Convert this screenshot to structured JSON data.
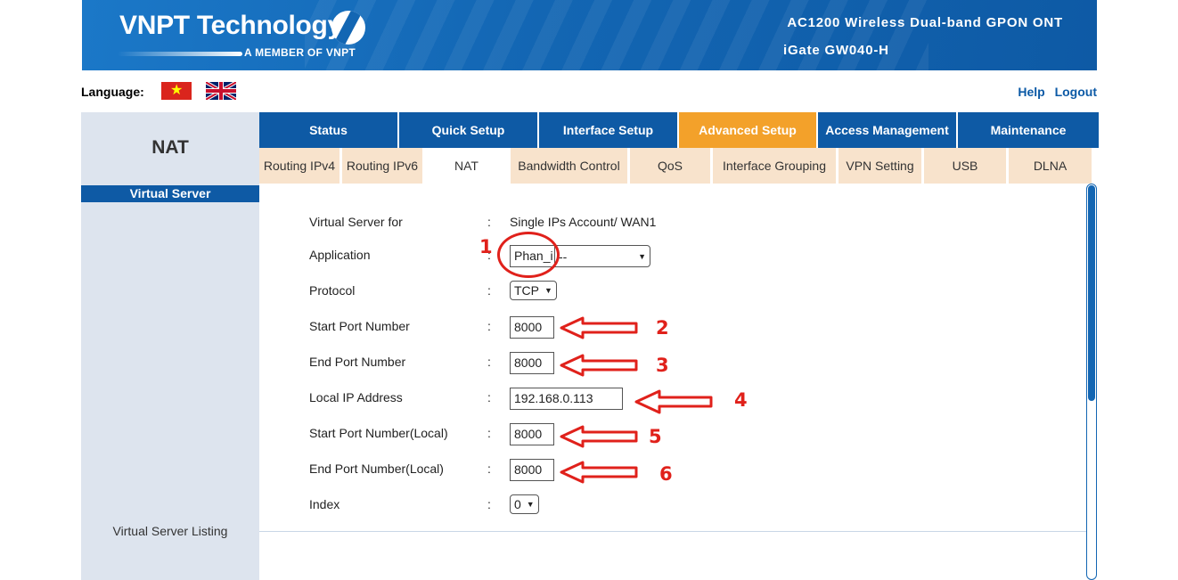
{
  "header": {
    "brand": "VNPT Technology",
    "brand_sub": "A MEMBER OF VNPT",
    "product_line1": "AC1200 Wireless Dual-band GPON ONT",
    "product_line2": "iGate GW040-H"
  },
  "language": {
    "label": "Language:"
  },
  "top_links": {
    "help": "Help",
    "logout": "Logout"
  },
  "main_tabs": [
    "Status",
    "Quick Setup",
    "Interface Setup",
    "Advanced Setup",
    "Access Management",
    "Maintenance"
  ],
  "sub_tabs": [
    "Routing IPv4",
    "Routing IPv6",
    "NAT",
    "Bandwidth Control",
    "QoS",
    "Interface Grouping",
    "VPN Setting",
    "USB",
    "DLNA"
  ],
  "left": {
    "title": "NAT",
    "section": "Virtual Server",
    "listing": "Virtual Server Listing"
  },
  "form": {
    "colon": ":",
    "virtual_server_for": {
      "label": "Virtual Server for",
      "value": "Single IPs Account/ WAN1"
    },
    "application": {
      "label": "Application",
      "input": "Phan_i",
      "select": "--"
    },
    "protocol": {
      "label": "Protocol",
      "value": "TCP"
    },
    "start_port": {
      "label": "Start Port Number",
      "value": "8000"
    },
    "end_port": {
      "label": "End Port Number",
      "value": "8000"
    },
    "local_ip": {
      "label": "Local IP Address",
      "value": "192.168.0.113"
    },
    "start_port_local": {
      "label": "Start Port Number(Local)",
      "value": "8000"
    },
    "end_port_local": {
      "label": "End Port Number(Local)",
      "value": "8000"
    },
    "index": {
      "label": "Index",
      "value": "0"
    }
  },
  "annotations": {
    "n1": "1",
    "n2": "2",
    "n3": "3",
    "n4": "4",
    "n5": "5",
    "n6": "6"
  },
  "colors": {
    "brand_blue": "#0e5aa5",
    "active_tab": "#f3a12a",
    "subtab_bg": "#f8e3cc",
    "annotation_red": "#e0211b"
  }
}
